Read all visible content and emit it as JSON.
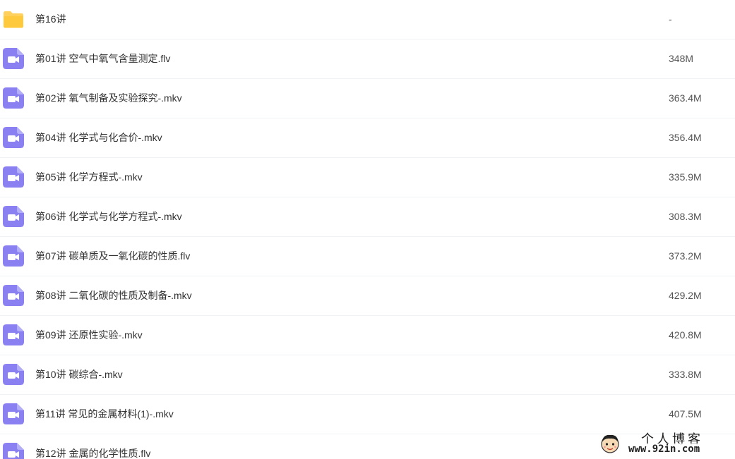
{
  "colors": {
    "folder_icon": "#FFD15C",
    "video_icon": "#8A80F2",
    "row_divider": "#F1F2F4",
    "text": "#333333"
  },
  "files": [
    {
      "name": "第16讲",
      "size": "-",
      "icon": "folder-icon"
    },
    {
      "name": "第01讲 空气中氧气含量测定.flv",
      "size": "348M",
      "icon": "video-file-icon"
    },
    {
      "name": "第02讲 氧气制备及实验探究-.mkv",
      "size": "363.4M",
      "icon": "video-file-icon"
    },
    {
      "name": "第04讲 化学式与化合价-.mkv",
      "size": "356.4M",
      "icon": "video-file-icon"
    },
    {
      "name": "第05讲 化学方程式-.mkv",
      "size": "335.9M",
      "icon": "video-file-icon"
    },
    {
      "name": "第06讲 化学式与化学方程式-.mkv",
      "size": "308.3M",
      "icon": "video-file-icon"
    },
    {
      "name": "第07讲 碳单质及一氧化碳的性质.flv",
      "size": "373.2M",
      "icon": "video-file-icon"
    },
    {
      "name": "第08讲 二氧化碳的性质及制备-.mkv",
      "size": "429.2M",
      "icon": "video-file-icon"
    },
    {
      "name": "第09讲 还原性实验-.mkv",
      "size": "420.8M",
      "icon": "video-file-icon"
    },
    {
      "name": "第10讲 碳综合-.mkv",
      "size": "333.8M",
      "icon": "video-file-icon"
    },
    {
      "name": "第11讲 常见的金属材料(1)-.mkv",
      "size": "407.5M",
      "icon": "video-file-icon"
    },
    {
      "name": "第12讲 金属的化学性质.flv",
      "size": "",
      "icon": "video-file-icon"
    }
  ],
  "watermark": {
    "title": "个人博客",
    "url": "www.92in.com",
    "icon": "cartoon-face-logo"
  }
}
